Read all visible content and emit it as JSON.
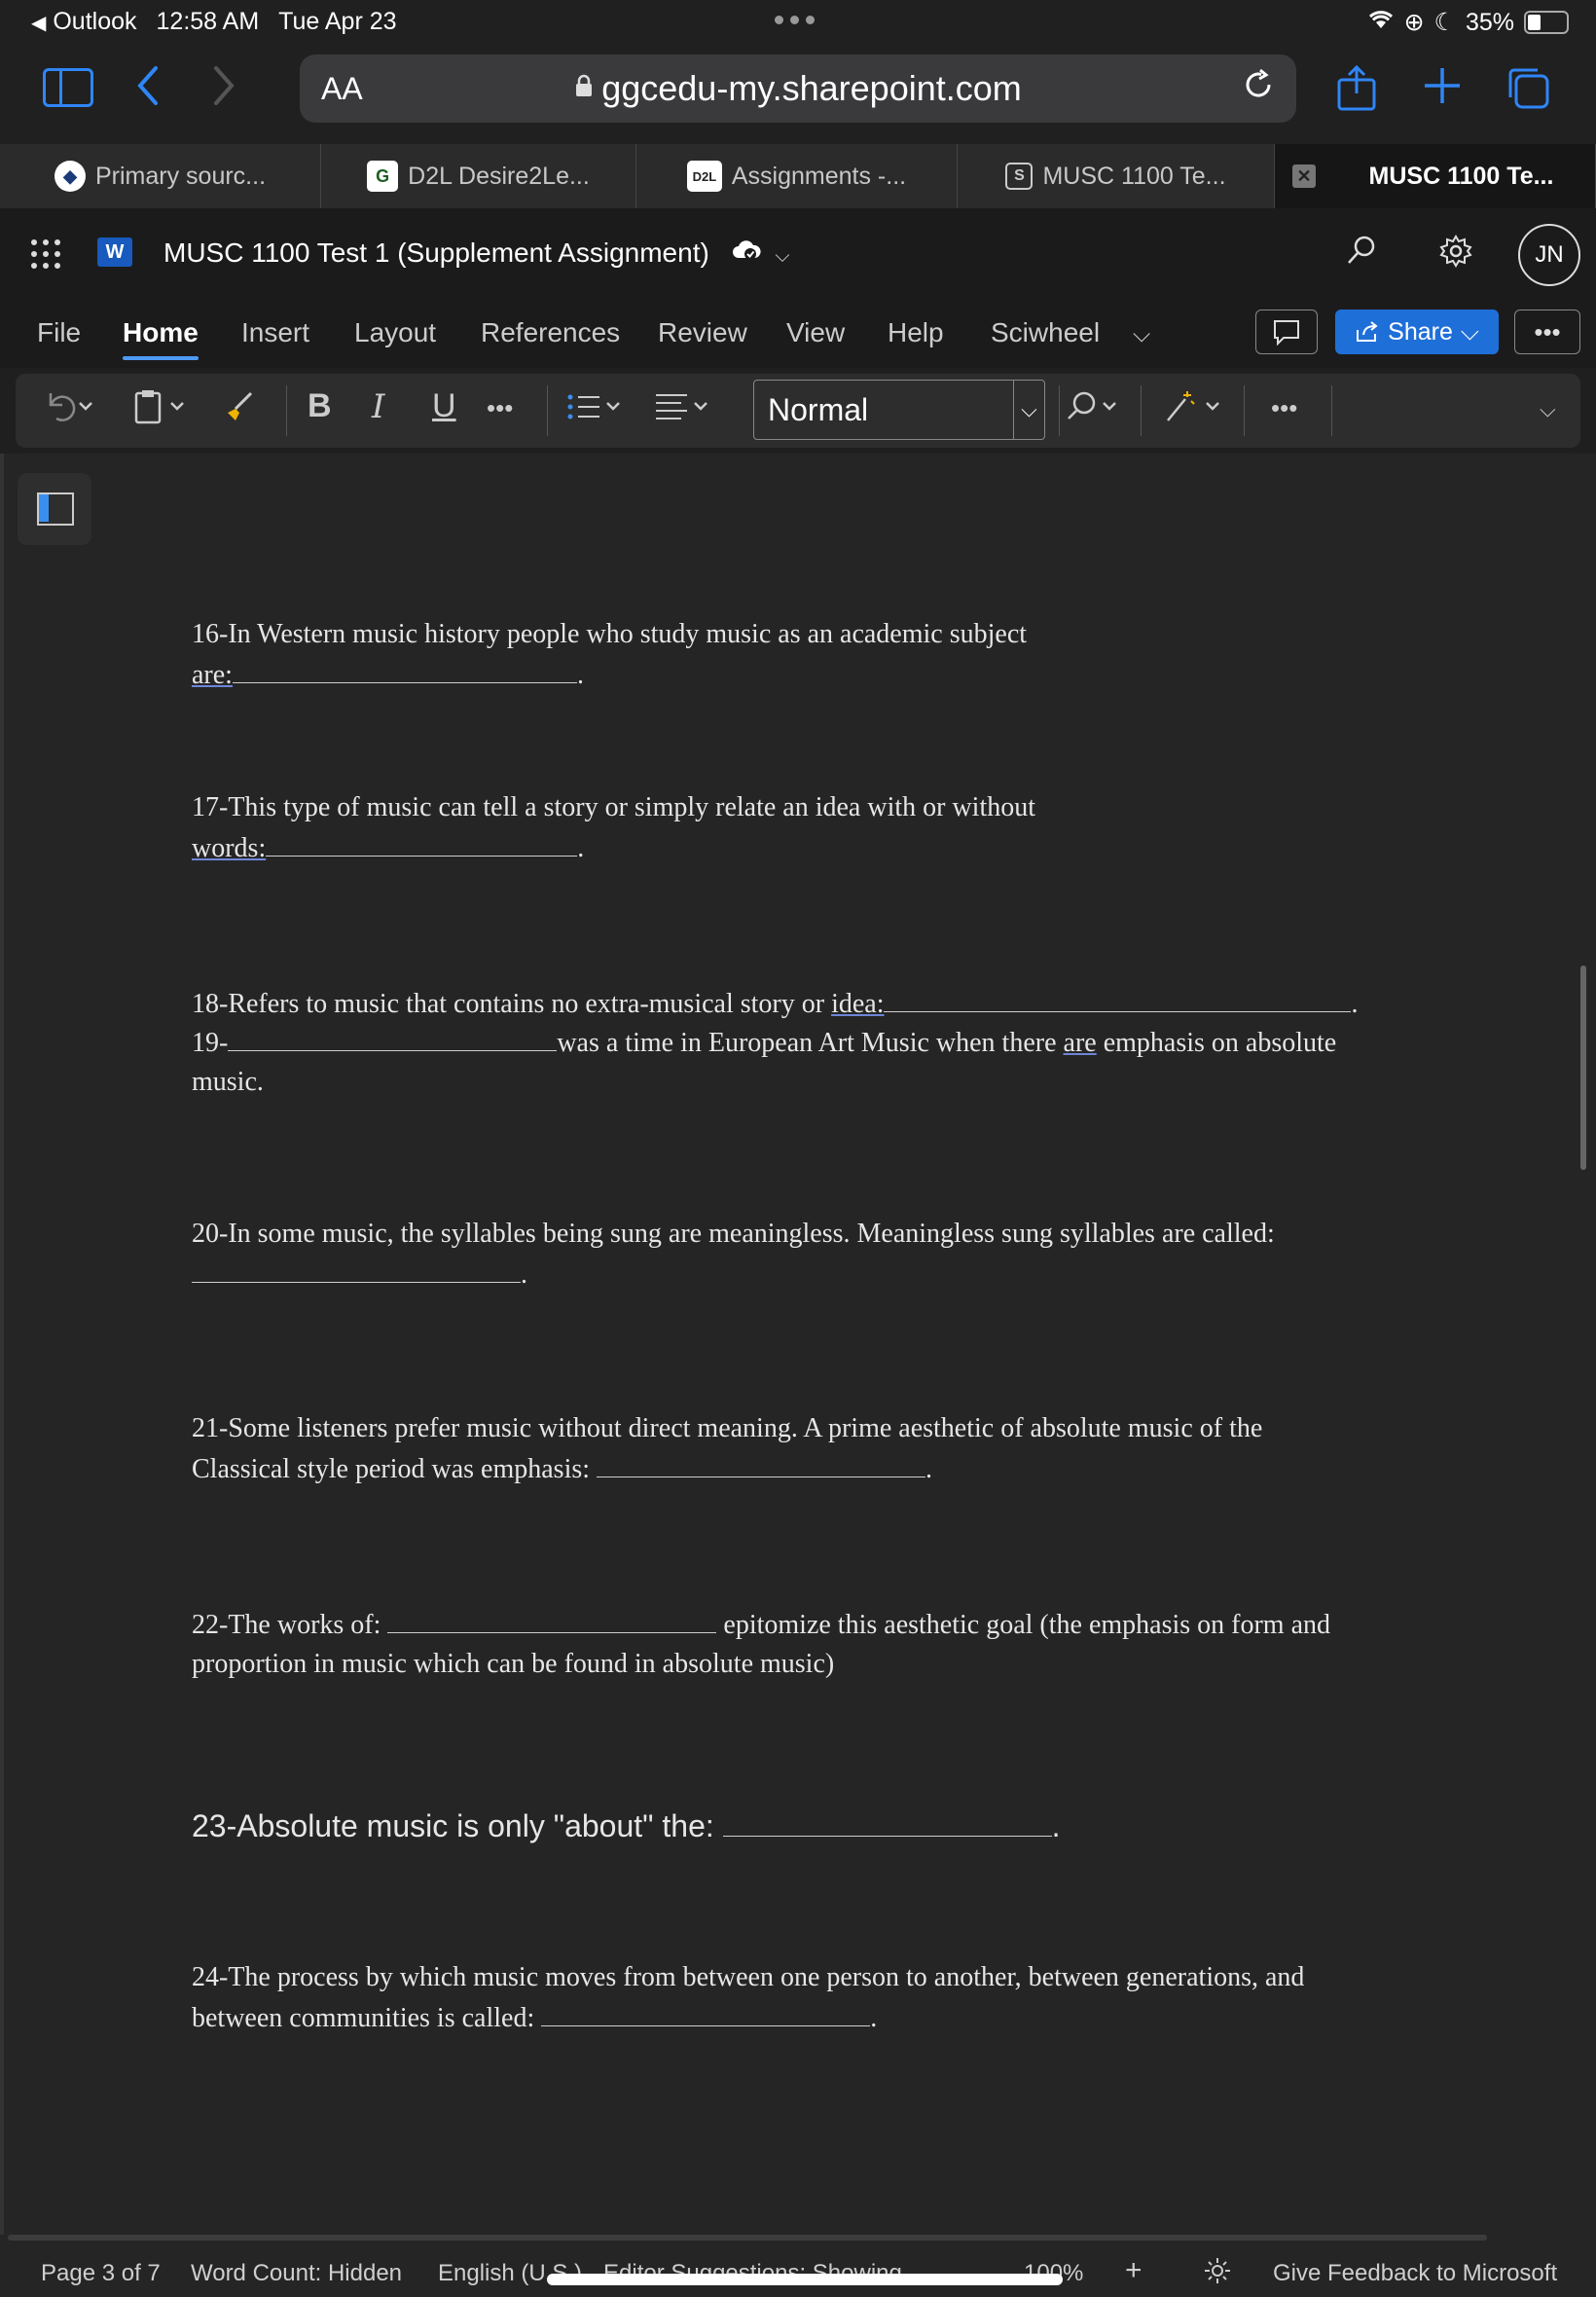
{
  "status_bar": {
    "back_app": "Outlook",
    "time": "12:58 AM",
    "date": "Tue Apr 23",
    "battery": "35%",
    "battery_level": 0.35
  },
  "browser": {
    "font_size_button": "AA",
    "url": "ggcedu-my.sharepoint.com",
    "tabs": [
      {
        "label": "Primary sourc...",
        "favicon": "◆"
      },
      {
        "label": "D2L Desire2Le...",
        "favicon": "G"
      },
      {
        "label": "Assignments -...",
        "favicon": "D2L"
      },
      {
        "label": "MUSC 1100 Te...",
        "favicon": "S"
      },
      {
        "label": "MUSC 1100 Te...",
        "active": true
      }
    ]
  },
  "word": {
    "doc_title": "MUSC 1100 Test 1 (Supplement Assignment)",
    "avatar_initials": "JN",
    "ribbon_tabs": [
      "File",
      "Home",
      "Insert",
      "Layout",
      "References",
      "Review",
      "View",
      "Help",
      "Sciwheel"
    ],
    "active_ribbon_tab": "Home",
    "share_label": "Share",
    "style_value": "Normal"
  },
  "questions": {
    "q16": {
      "text": "16-In Western music history people who study music as an academic subject",
      "line2": "are:"
    },
    "q17": {
      "text": "17-This type of music can tell a story or simply relate an idea with or without",
      "line2": "words:"
    },
    "q18": {
      "text": "18-Refers to music that contains no extra-musical story or",
      "underlined": "idea:"
    },
    "q19": {
      "prefix": "19-",
      "text": "was a time in European Art Music when there",
      "underlined": "are",
      "text2": "emphasis on absolute",
      "line2": "music."
    },
    "q20": {
      "text": "20-In some music, the syllables being sung are meaningless. Meaningless sung syllables are called:"
    },
    "q21": {
      "text": "21-Some listeners prefer music without direct meaning. A prime aesthetic of absolute music of the",
      "line2": "Classical style period was emphasis:"
    },
    "q22": {
      "text": "22-The works of:",
      "text2": "epitomize this aesthetic goal (the emphasis on form and",
      "line2": "proportion in music which can be found in absolute music)"
    },
    "q23": {
      "text": "23-Absolute music is only \"about\" the:"
    },
    "q24": {
      "text": "24-The process by which music moves from between one person to another, between generations, and",
      "line2": "between communities is called:"
    }
  },
  "footer": {
    "page": "Page 3 of 7",
    "word_count": "Word Count: Hidden",
    "language": "English (U.S.)",
    "editor": "Editor Suggestions: Showing",
    "zoom": "100%",
    "feedback": "Give Feedback to Microsoft"
  }
}
